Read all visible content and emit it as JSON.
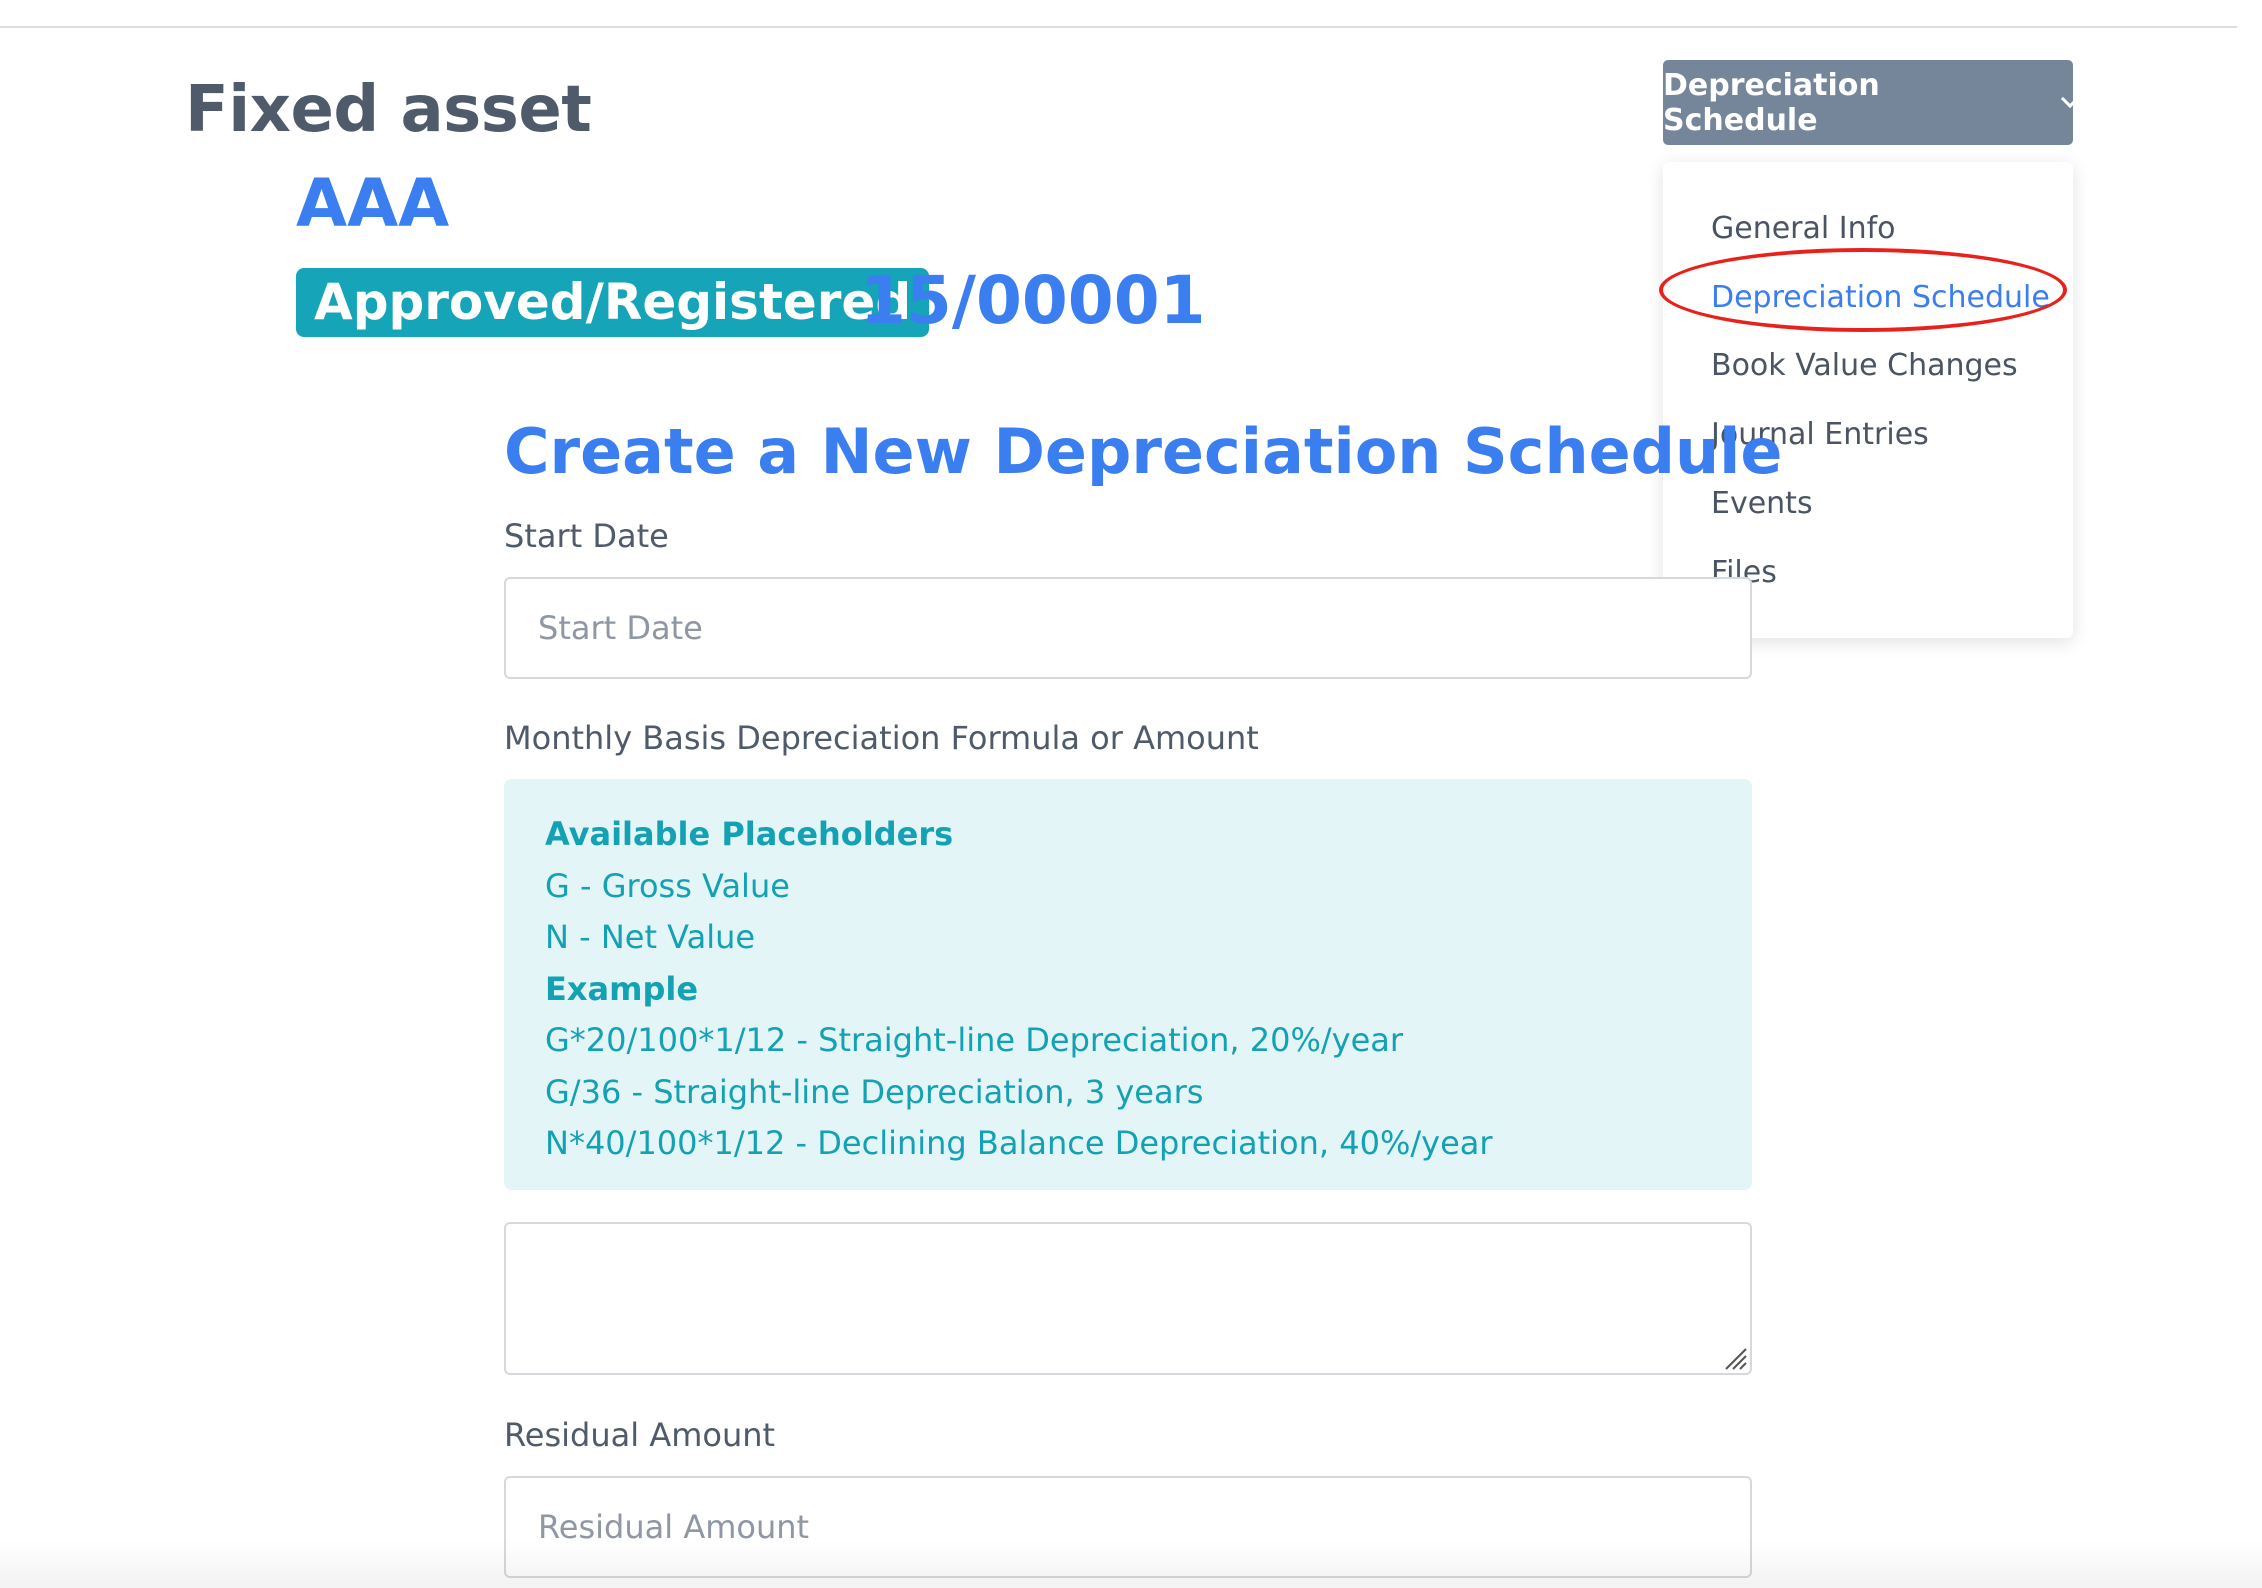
{
  "header": {
    "page_title": "Fixed asset",
    "asset_name": "AAA",
    "status_badge": "Approved/Registered",
    "asset_number": "15/00001"
  },
  "section_dropdown": {
    "selected_label": "Depreciation Schedule",
    "icon": "chevron-down-icon",
    "items": [
      {
        "label": "General Info"
      },
      {
        "label": "Depreciation Schedule",
        "active": true
      },
      {
        "label": "Book Value Changes"
      },
      {
        "label": "Journal Entries"
      },
      {
        "label": "Events"
      },
      {
        "label": "Files"
      }
    ]
  },
  "form": {
    "heading": "Create a New Depreciation Schedule",
    "start_date": {
      "label": "Start Date",
      "placeholder": "Start Date",
      "value": ""
    },
    "formula": {
      "label": "Monthly Basis Depreciation Formula or Amount",
      "help": {
        "placeholders_title": "Available Placeholders",
        "placeholders": [
          "G - Gross Value",
          "N - Net Value"
        ],
        "example_title": "Example",
        "examples": [
          "G*20/100*1/12 - Straight-line Depreciation, 20%/year",
          "G/36 - Straight-line Depreciation, 3 years",
          "N*40/100*1/12 - Declining Balance Depreciation, 40%/year"
        ]
      },
      "value": ""
    },
    "residual_amount": {
      "label": "Residual Amount",
      "placeholder": "Residual Amount",
      "value": ""
    }
  },
  "colors": {
    "accent_blue": "#3a7ef0",
    "badge_teal": "#16a4b8",
    "info_bg": "#e3f5f7",
    "dropdown_button_bg": "#75859a",
    "annotation_red": "#e8221b"
  }
}
